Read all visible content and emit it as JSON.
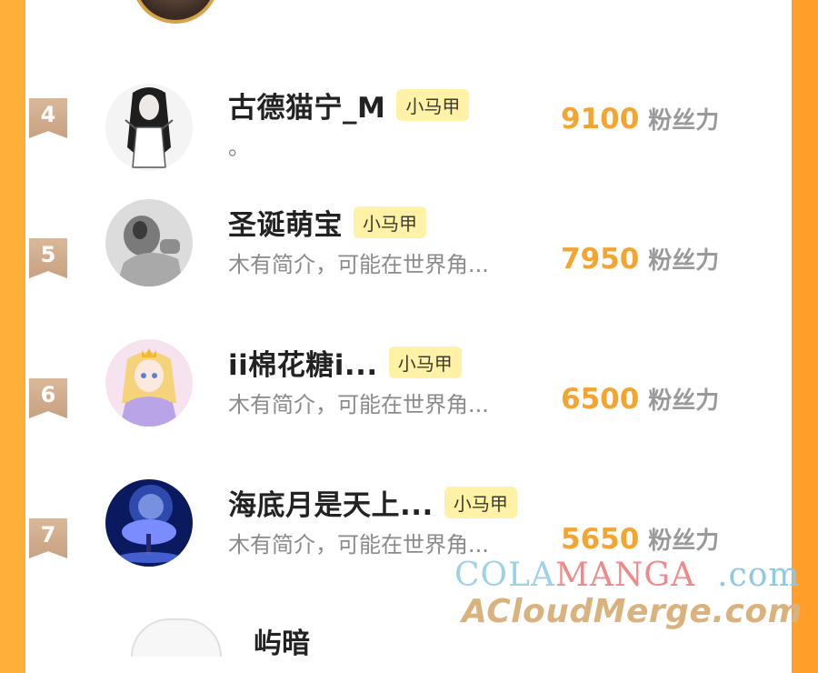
{
  "ranking": {
    "rows": [
      {
        "rank": "4",
        "name": "古德猫宁_M",
        "tag": "小马甲",
        "bio": "。",
        "score": "9100",
        "unit": "粉丝力"
      },
      {
        "rank": "5",
        "name": "圣诞萌宝",
        "tag": "小马甲",
        "bio": "木有简介，可能在世界角...",
        "score": "7950",
        "unit": "粉丝力"
      },
      {
        "rank": "6",
        "name": "ii棉花糖i...",
        "tag": "小马甲",
        "bio": "木有简介，可能在世界角...",
        "score": "6500",
        "unit": "粉丝力"
      },
      {
        "rank": "7",
        "name": "海底月是天上...",
        "tag": "小马甲",
        "bio": "木有简介，可能在世界角...",
        "score": "5650",
        "unit": "粉丝力"
      }
    ],
    "partial_next_name": "屿暗"
  },
  "watermark": {
    "line1_part1": "COLA",
    "line1_part2": "MANGA",
    "line1_part3": ".com",
    "line2": "ACloudMerge.com"
  },
  "colors": {
    "background": "#ffa534",
    "score": "#f4a431",
    "tag_bg": "#fff1a6",
    "badge": "#cfa98a"
  }
}
